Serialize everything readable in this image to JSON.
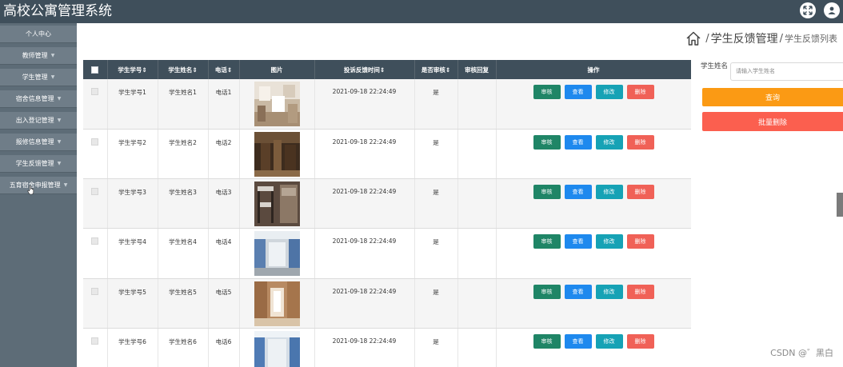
{
  "app": {
    "title": "高校公寓管理系统"
  },
  "header": {
    "icons": [
      "expand-icon",
      "user-icon"
    ]
  },
  "sidebar": {
    "items": [
      {
        "label": "个人中心"
      },
      {
        "label": "教师管理"
      },
      {
        "label": "学生管理"
      },
      {
        "label": "宿舍信息管理"
      },
      {
        "label": "出入登记管理"
      },
      {
        "label": "报修信息管理"
      },
      {
        "label": "学生反馈管理"
      },
      {
        "label": "五育宿舍申报管理"
      }
    ]
  },
  "breadcrumb": {
    "section": "学生反馈管理",
    "page": "学生反馈列表",
    "separator": "/"
  },
  "table": {
    "columns": [
      "学生学号",
      "学生姓名",
      "电话",
      "图片",
      "投诉反馈时间",
      "是否审核",
      "审核回复",
      "操作"
    ],
    "actions": {
      "audit": "审核",
      "view": "查看",
      "edit": "修改",
      "delete": "删除"
    },
    "rows": [
      {
        "id": "学生学号1",
        "name": "学生姓名1",
        "phone": "电话1",
        "time": "2021-09-18 22:24:49",
        "audited": "是",
        "reply": ""
      },
      {
        "id": "学生学号2",
        "name": "学生姓名2",
        "phone": "电话2",
        "time": "2021-09-18 22:24:49",
        "audited": "是",
        "reply": ""
      },
      {
        "id": "学生学号3",
        "name": "学生姓名3",
        "phone": "电话3",
        "time": "2021-09-18 22:24:49",
        "audited": "是",
        "reply": ""
      },
      {
        "id": "学生学号4",
        "name": "学生姓名4",
        "phone": "电话4",
        "time": "2021-09-18 22:24:49",
        "audited": "是",
        "reply": ""
      },
      {
        "id": "学生学号5",
        "name": "学生姓名5",
        "phone": "电话5",
        "time": "2021-09-18 22:24:49",
        "audited": "是",
        "reply": ""
      },
      {
        "id": "学生学号6",
        "name": "学生姓名6",
        "phone": "电话6",
        "time": "2021-09-18 22:24:49",
        "audited": "是",
        "reply": ""
      }
    ]
  },
  "search": {
    "label": "学生姓名",
    "placeholder": "请输入学生姓名",
    "query_button": "查询",
    "batch_delete_button": "批量删除"
  },
  "watermark": "CSDN @゛黑白",
  "colors": {
    "topbar": "#3f4f5b",
    "sidebar": "#5d6c77",
    "audit": "#1f8566",
    "view": "#1e89ee",
    "edit": "#16a2b5",
    "delete": "#f06157",
    "query": "#fb9a14",
    "batch_delete": "#fb5f4f"
  }
}
